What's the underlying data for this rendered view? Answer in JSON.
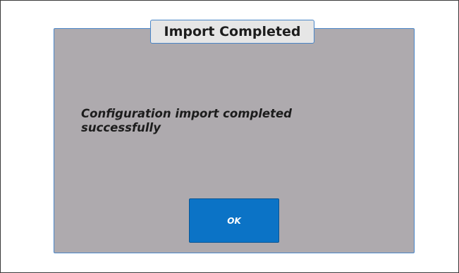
{
  "dialog": {
    "title": "Import Completed",
    "message": "Configuration import completed successfully",
    "ok_label": "OK"
  },
  "colors": {
    "dialog_background": "#aeaaae",
    "dialog_border": "#4a86c8",
    "title_tab_background": "#e6e6e6",
    "button_background": "#0b73c6",
    "button_text": "#ffffff"
  }
}
